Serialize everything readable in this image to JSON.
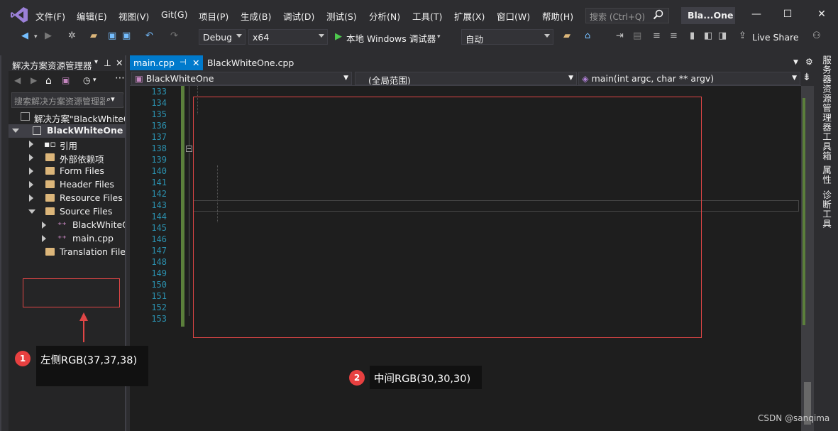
{
  "menu": {
    "items": [
      "文件(F)",
      "编辑(E)",
      "视图(V)",
      "Git(G)",
      "项目(P)",
      "生成(B)",
      "调试(D)",
      "测试(S)",
      "分析(N)",
      "工具(T)",
      "扩展(X)",
      "窗口(W)",
      "帮助(H)"
    ],
    "search_placeholder": "搜索 (Ctrl+Q)",
    "title": "Bla...One"
  },
  "toolbar": {
    "config": "Debug",
    "platform": "x64",
    "run_label": "本地 Windows 调试器",
    "auto": "自动",
    "live_share": "Live Share"
  },
  "solution_explorer": {
    "title": "解决方案资源管理器",
    "search_placeholder": "搜索解决方案资源管理器(Ctrl+;)",
    "items": [
      {
        "label": "解决方案\"BlackWhiteOne\""
      },
      {
        "label": "BlackWhiteOne"
      },
      {
        "label": "引用"
      },
      {
        "label": "外部依赖项"
      },
      {
        "label": "Form Files"
      },
      {
        "label": "Header Files"
      },
      {
        "label": "Resource Files"
      },
      {
        "label": "Source Files"
      },
      {
        "label": "BlackWhiteOne"
      },
      {
        "label": "main.cpp"
      },
      {
        "label": "Translation Files"
      }
    ]
  },
  "editor": {
    "tabs": [
      {
        "label": "main.cpp"
      },
      {
        "label": "BlackWhiteOne.cpp"
      }
    ],
    "nav_project": "BlackWhiteOne",
    "nav_scope": "(全局范围)",
    "nav_function": "main(int argc, char ** argv)",
    "line_numbers": [
      "133",
      "134",
      "135",
      "136",
      "137",
      "138",
      "139",
      "140",
      "141",
      "142",
      "143",
      "144",
      "145",
      "146",
      "147",
      "148",
      "149",
      "150",
      "151",
      "152",
      "153"
    ]
  },
  "side_tabs": [
    "服务器资源管理器",
    "工具箱",
    "属性",
    "诊断工具"
  ],
  "annotations": {
    "badge1": "1",
    "label1": "左侧RGB(37,37,38)",
    "badge2": "2",
    "label2": "中间RGB(30,30,30)"
  },
  "watermark": "CSDN @sanqima",
  "colors": {
    "accent": "#007acc",
    "left_panel_bg": "#252526",
    "editor_bg": "#1e1e1e",
    "annotation_red": "#e04646"
  }
}
